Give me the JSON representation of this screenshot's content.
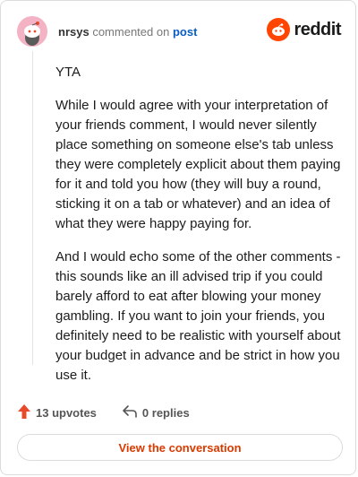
{
  "header": {
    "username": "nrsys",
    "action_text": "commented on",
    "post_link": "post",
    "brand_word": "reddit"
  },
  "comment": {
    "paragraphs": [
      "YTA",
      "While I would agree with your interpretation of your friends comment, I would never silently place something on someone else's tab unless they were completely explicit about them paying for it and told you how (they will buy a round, sticking it on a tab or whatever) and an idea of what they were happy paying for.",
      "And I would echo some of the other comments - this sounds like an ill advised trip if you could barely afford to eat after blowing your money gambling. If you want to join your friends, you definitely need to be realistic with yourself about your budget in advance and be strict in how you use it."
    ]
  },
  "footer": {
    "upvotes_label": "13 upvotes",
    "replies_label": "0 replies"
  },
  "cta": {
    "label": "View the conversation"
  },
  "colors": {
    "brand": "#ff4500",
    "upvote_arrow": "#e8492a",
    "link": "#0a5ebf",
    "cta_text": "#d93a00"
  },
  "icons": {
    "avatar": "snoo-avatar-icon",
    "logo": "reddit-logo-icon",
    "upvote": "upvote-arrow-icon",
    "reply": "reply-arrow-icon"
  }
}
